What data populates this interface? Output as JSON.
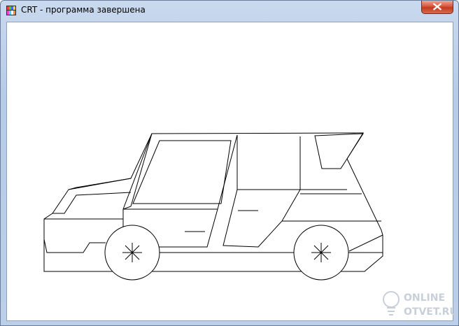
{
  "window": {
    "title": "CRT - программа завершена",
    "icon": "crt-app-icon",
    "close_icon": "close-x-icon"
  },
  "drawing": {
    "subject": "car-outline",
    "line_color": "#000000",
    "background_color": "#ffffff"
  },
  "watermark": {
    "line1": "ONLINE",
    "line2": "OTVET.RU",
    "icon": "lightbulb-icon"
  },
  "colors": {
    "frame": "#bccfe8",
    "close_button": "#c9452a"
  }
}
